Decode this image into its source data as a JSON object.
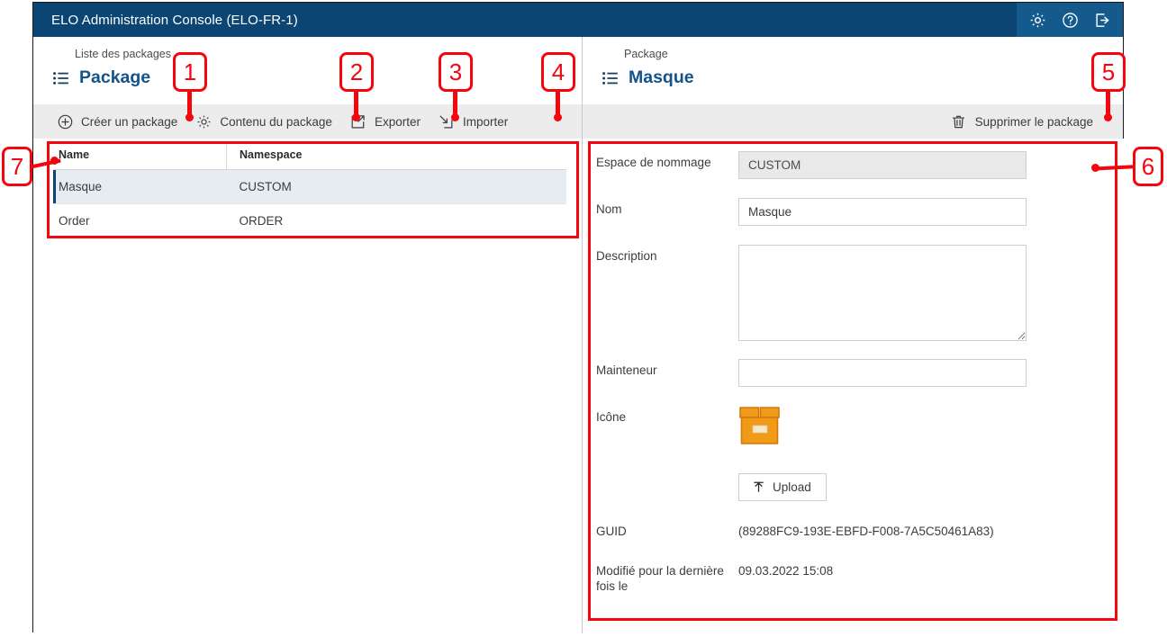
{
  "window": {
    "title": "ELO Administration Console (ELO-FR-1)",
    "title_icons": [
      {
        "name": "gear-icon",
        "label": "Settings"
      },
      {
        "name": "help-icon",
        "label": "Help"
      },
      {
        "name": "logout-icon",
        "label": "Logout"
      }
    ]
  },
  "left_pane": {
    "breadcrumb": "Liste des packages",
    "title": "Package",
    "toolbar": [
      {
        "label": "Créer un package",
        "icon": "plus-circle-icon"
      },
      {
        "label": "Contenu du package",
        "icon": "gear-icon"
      },
      {
        "label": "Exporter",
        "icon": "export-icon"
      },
      {
        "label": "Importer",
        "icon": "import-icon"
      }
    ],
    "table": {
      "columns": [
        "Name",
        "Namespace"
      ],
      "rows": [
        {
          "name": "Masque",
          "namespace": "CUSTOM",
          "selected": true
        },
        {
          "name": "Order",
          "namespace": "ORDER",
          "selected": false
        }
      ]
    }
  },
  "right_pane": {
    "breadcrumb": "Package",
    "title": "Masque",
    "toolbar": [
      {
        "label": "Supprimer le package",
        "icon": "trash-icon"
      }
    ],
    "form": {
      "namespace_label": "Espace de nommage",
      "namespace_value": "CUSTOM",
      "name_label": "Nom",
      "name_value": "Masque",
      "description_label": "Description",
      "description_value": "",
      "maintainer_label": "Mainteneur",
      "maintainer_value": "",
      "icon_label": "Icône",
      "icon_name": "package-box-icon",
      "upload_label": "Upload",
      "guid_label": "GUID",
      "guid_value": "(89288FC9-193E-EBFD-F008-7A5C50461A83)",
      "modified_label": "Modifié pour la dernière fois le",
      "modified_value": "09.03.2022 15:08"
    }
  },
  "annotations": {
    "markers": [
      {
        "id": "1",
        "text": "1"
      },
      {
        "id": "2",
        "text": "2"
      },
      {
        "id": "3",
        "text": "3"
      },
      {
        "id": "4",
        "text": "4"
      },
      {
        "id": "5",
        "text": "5"
      },
      {
        "id": "6",
        "text": "6"
      },
      {
        "id": "7",
        "text": "7"
      }
    ],
    "color": "#f5050d"
  }
}
